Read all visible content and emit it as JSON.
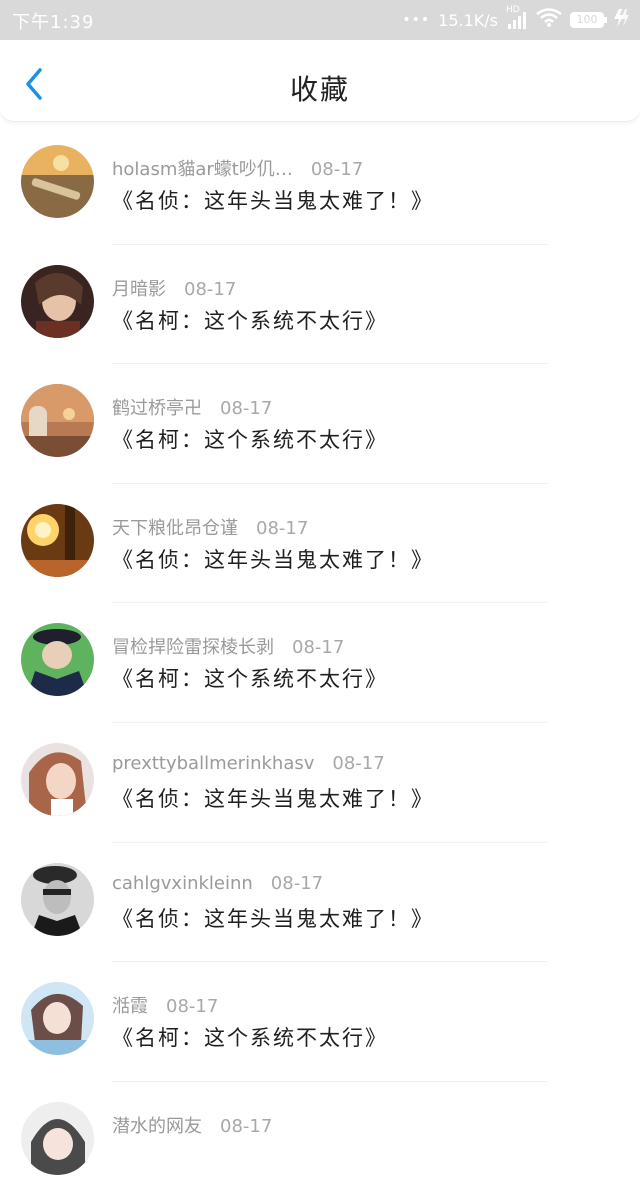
{
  "status_bar": {
    "time": "下午1:39",
    "dots": "•••",
    "speed": "15.1K/s",
    "network": "HD",
    "battery": "100"
  },
  "header": {
    "title": "收藏"
  },
  "colors": {
    "accent": "#1e90e6",
    "status_bar_bg": "#d9d9d9"
  },
  "favorites": [
    {
      "user": "holasm貓ar蠓t吵仉…",
      "date": "08-17",
      "title": "《名侦：这年头当鬼太难了！》",
      "avatar": "avatar-sunset-beach"
    },
    {
      "user": "月暗影",
      "date": "08-17",
      "title": "《名柯：这个系统不太行》",
      "avatar": "avatar-anime-girl-dark"
    },
    {
      "user": "鹤过桥亭卍",
      "date": "08-17",
      "title": "《名柯：这个系统不太行》",
      "avatar": "avatar-sunset-person"
    },
    {
      "user": "天下粮仳昂仓谨",
      "date": "08-17",
      "title": "《名侦：这年头当鬼太难了！》",
      "avatar": "avatar-sunlight-forest"
    },
    {
      "user": "冒检捍险雷探棱长剥",
      "date": "08-17",
      "title": "《名柯：这个系统不太行》",
      "avatar": "avatar-student-cap"
    },
    {
      "user": "prexttyballmerinkhasv",
      "date": "08-17",
      "title": "《名侦：这年头当鬼太难了！》",
      "avatar": "avatar-girl-photo"
    },
    {
      "user": "cahlgvxinkleinn",
      "date": "08-17",
      "title": "《名侦：这年头当鬼太难了！》",
      "avatar": "avatar-bw-portrait"
    },
    {
      "user": "湉霞",
      "date": "08-17",
      "title": "《名柯：这个系统不太行》",
      "avatar": "avatar-anime-blue"
    },
    {
      "user": "潜水的网友",
      "date": "08-17",
      "title": "",
      "avatar": "avatar-anime-girl-light"
    }
  ]
}
